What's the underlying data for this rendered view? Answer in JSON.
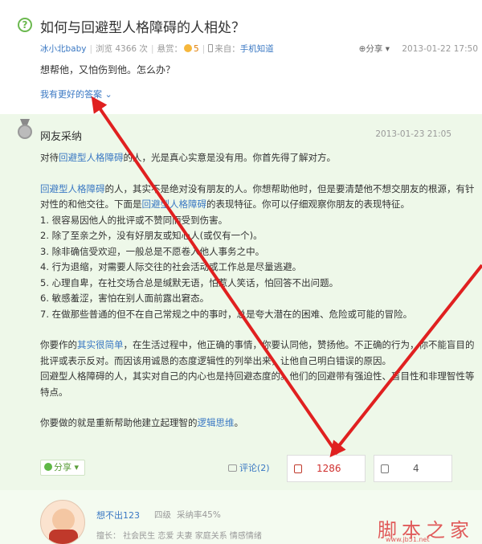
{
  "question": {
    "title": "如何与回避型人格障碍的人相处？",
    "author": "冰小北baby",
    "views": "浏览 4366 次",
    "reward_label": "悬赏：",
    "reward_value": "5",
    "source_label": "来自：",
    "source_value": "手机知道",
    "share": "分享",
    "date": "2013-01-22 17:50",
    "description": "想帮他，又怕伤到他。怎么办？",
    "better_answer": "我有更好的答案"
  },
  "answer": {
    "label": "网友采纳",
    "date": "2013-01-23 21:05",
    "p1": [
      "对待",
      "回避型人格障碍",
      "的人，光是真心实意是没有用。你首先得了解对方。"
    ],
    "p2a": [
      "回避型人格障碍",
      "的人，其实不是绝对没有朋友的人。你想帮助他时，但是要清楚他不想交朋友的根源，有针对性的和他交往。下面是",
      "回避型人格障碍",
      "的表现特征。你可以仔细观察你朋友的表现特征。"
    ],
    "list": [
      "1. 很容易因他人的批评或不赞同而受到伤害。",
      "2. 除了至亲之外，没有好朋友或知心人(或仅有一个)。",
      "3. 除非确信受欢迎，一般总是不愿卷入他人事务之中。",
      "4. 行为退缩，对需要人际交往的社会活动或工作总是尽量逃避。",
      "5. 心理自卑，在社交场合总是缄默无语，怕惹人笑话，怕回答不出问题。",
      "6. 敏感羞涩，害怕在别人面前露出窘态。",
      "7. 在做那些普通的但不在自己常规之中的事时，总是夸大潜在的困难、危险或可能的冒险。"
    ],
    "p3": [
      "你要作的",
      "其实很简单",
      "，在生活过程中，他正确的事情，你要认同他，赞扬他。不正确的行为，你不能盲目的批评或表示反对。而因该用诚恳的态度逻辑性的列举出来，让他自己明白错误的原因。"
    ],
    "p4": "回避型人格障碍的人，其实对自己的内心也是持回避态度的。他们的回避带有强迫性、盲目性和非理智性等特点。",
    "p5": [
      "你要做的就是重新帮助他建立起理智的",
      "逻辑思维",
      "。"
    ],
    "share": "分享",
    "comment": "评论(2)",
    "upvotes": "1286",
    "downvotes": "4"
  },
  "user": {
    "name": "想不出123",
    "level": "四级",
    "rate": "采纳率45%",
    "expertise": "擅长：  社会民生   恋爱   夫妻   家庭关系   情感情绪"
  },
  "watermark": {
    "text": "脚本之家",
    "url": "www.jb51.net"
  },
  "colors": {
    "link": "#3a78c3",
    "answer_bg": "#eef8e9",
    "arrow": "#e02020",
    "upvote": "#d0302f"
  }
}
